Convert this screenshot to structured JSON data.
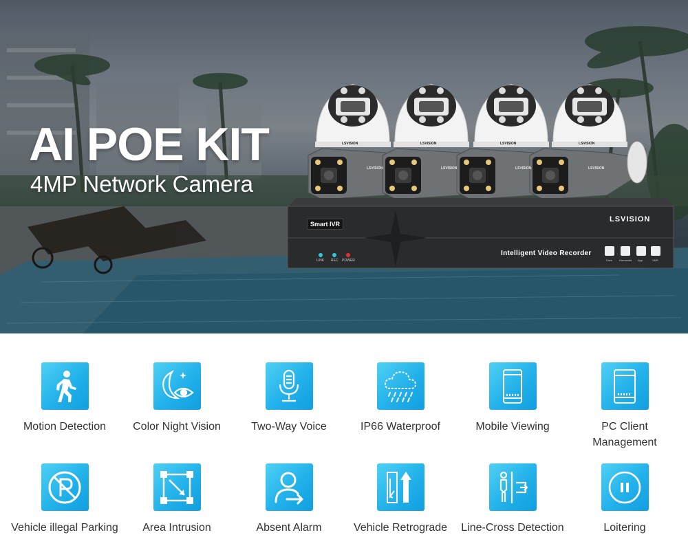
{
  "hero": {
    "title": "AI POE KIT",
    "subtitle": "4MP Network Camera"
  },
  "nvr": {
    "brand": "LSVISION",
    "model": "Smart IVR",
    "caption": "Intelligent Video Recorder",
    "leds": [
      "LINK",
      "REC",
      "POWER"
    ],
    "functions": [
      "Face",
      "Humanoid",
      "App",
      "VMS"
    ]
  },
  "cameras": {
    "brand": "LSVISION"
  },
  "colors": {
    "tile_light": "#4fd0f4",
    "tile_dark": "#129ee0",
    "label_text": "#333333"
  },
  "features": [
    {
      "label": "Motion Detection",
      "icon": "walking-person-icon"
    },
    {
      "label": "Color Night Vision",
      "icon": "moon-eye-icon"
    },
    {
      "label": "Two-Way Voice",
      "icon": "microphone-icon"
    },
    {
      "label": "IP66 Waterproof",
      "icon": "cloud-rain-icon"
    },
    {
      "label": "Mobile Viewing",
      "icon": "smartphone-icon"
    },
    {
      "label": "PC Client Management",
      "icon": "tablet-icon"
    },
    {
      "label": "Vehicle illegal Parking",
      "icon": "no-parking-icon"
    },
    {
      "label": "Area Intrusion",
      "icon": "area-frame-icon"
    },
    {
      "label": "Absent Alarm",
      "icon": "person-away-icon"
    },
    {
      "label": "Vehicle Retrograde",
      "icon": "wrong-way-icon"
    },
    {
      "label": "Line-Cross Detection",
      "icon": "line-cross-icon"
    },
    {
      "label": "Loitering",
      "icon": "pause-circle-icon"
    }
  ]
}
